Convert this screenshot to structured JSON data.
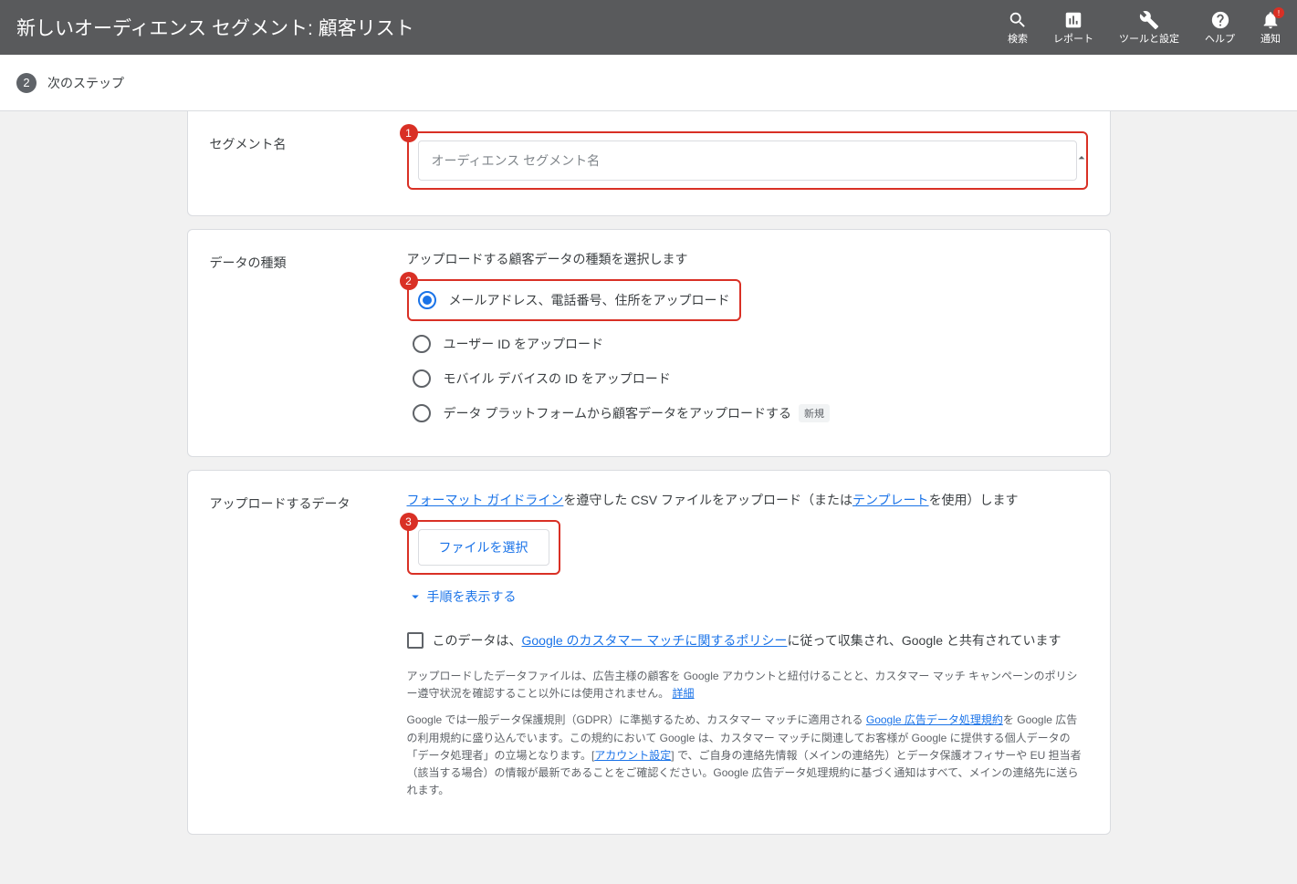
{
  "header": {
    "title": "新しいオーディエンス セグメント: 顧客リスト",
    "actions": {
      "search": "検索",
      "reports": "レポート",
      "tools": "ツールと設定",
      "help": "ヘルプ",
      "notifications": "通知",
      "alert": "!"
    }
  },
  "subheader": {
    "step_num": "2",
    "step_label": "次のステップ"
  },
  "segment": {
    "label": "セグメント名",
    "placeholder": "オーディエンス セグメント名",
    "annot": "1"
  },
  "datatype": {
    "label": "データの種類",
    "prompt": "アップロードする顧客データの種類を選択します",
    "annot": "2",
    "options": [
      {
        "label": "メールアドレス、電話番号、住所をアップロード",
        "checked": true
      },
      {
        "label": "ユーザー ID をアップロード",
        "checked": false
      },
      {
        "label": "モバイル デバイスの ID をアップロード",
        "checked": false
      },
      {
        "label": "データ プラットフォームから顧客データをアップロードする",
        "checked": false,
        "badge": "新規"
      }
    ]
  },
  "upload": {
    "label": "アップロードするデータ",
    "sentence": {
      "link1": "フォーマット ガイドライン",
      "mid": "を遵守した CSV ファイルをアップロード（または",
      "link2": "テンプレート",
      "tail": "を使用）します"
    },
    "annot": "3",
    "file_btn": "ファイルを選択",
    "expand": "手順を表示する",
    "compliance": {
      "pre": "このデータは、",
      "link": "Google のカスタマー マッチに関するポリシー",
      "post": "に従って収集され、Google と共有されています"
    },
    "fineprint1": {
      "text": "アップロードしたデータファイルは、広告主様の顧客を Google アカウントと紐付けることと、カスタマー マッチ キャンペーンのポリシー遵守状況を確認すること以外には使用されません。",
      "link": "詳細"
    },
    "fineprint2": {
      "p1": "Google では一般データ保護規則（GDPR）に準拠するため、カスタマー マッチに適用される ",
      "link1": "Google 広告データ処理規約",
      "p2": "を Google 広告の利用規約に盛り込んでいます。この規約において Google は、カスタマー マッチに関連してお客様が Google に提供する個人データの「データ処理者」の立場となります。[",
      "link2": "アカウント設定",
      "p3": "] で、ご自身の連絡先情報（メインの連絡先）とデータ保護オフィサーや EU 担当者（該当する場合）の情報が最新であることをご確認ください。Google 広告データ処理規約に基づく通知はすべて、メインの連絡先に送られます。"
    }
  }
}
